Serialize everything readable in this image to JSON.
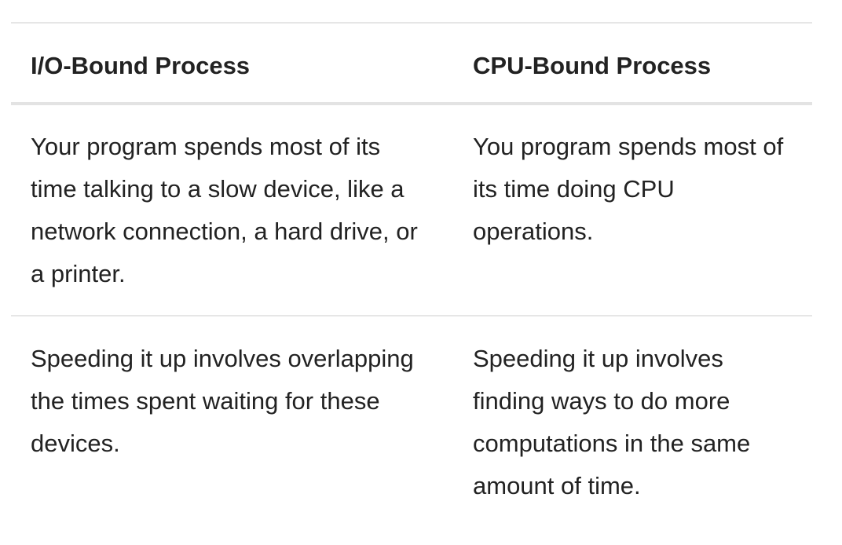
{
  "table": {
    "headers": [
      "I/O-Bound Process",
      "CPU-Bound Process"
    ],
    "rows": [
      [
        "Your program spends most of its time talking to a slow device, like a network connection, a hard drive, or a printer.",
        "You program spends most of its time doing CPU operations."
      ],
      [
        "Speeding it up involves overlapping the times spent waiting for these devices.",
        "Speeding it up involves finding ways to do more computations in the same amount of time."
      ]
    ]
  }
}
